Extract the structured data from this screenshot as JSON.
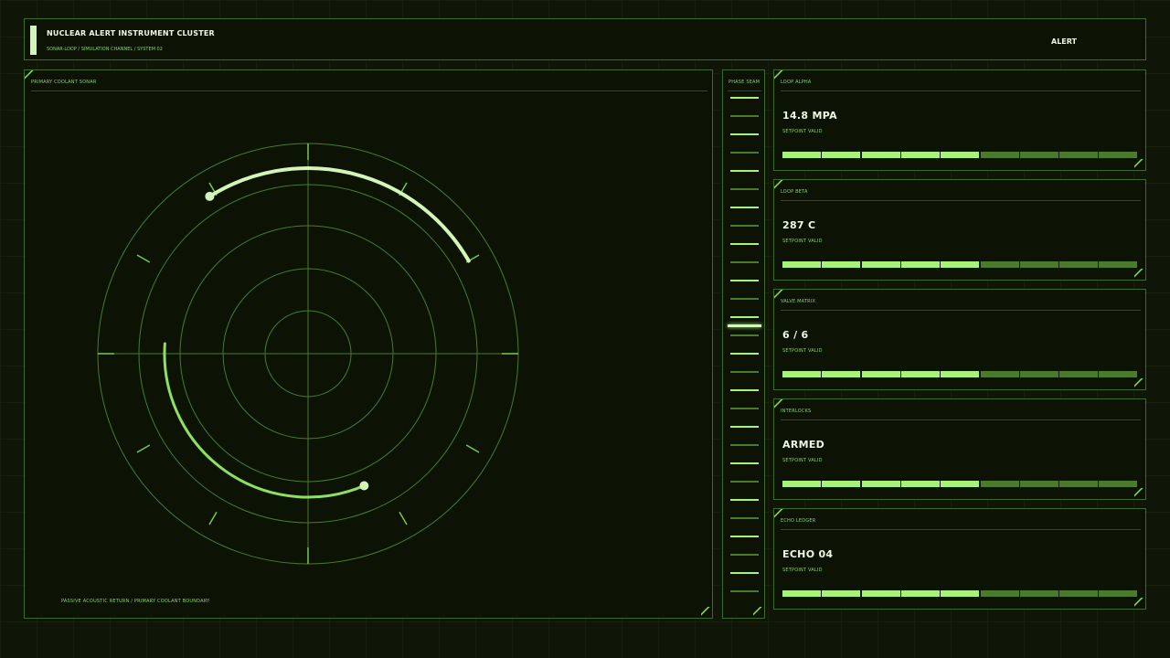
{
  "header": {
    "title": "NUCLEAR ALERT INSTRUMENT CLUSTER",
    "subtitle": "SONAR-LOOP / SIMULATION CHANNEL / SYSTEM 02",
    "status": "ALERT"
  },
  "sonar": {
    "label": "PRIMARY COOLANT SONAR",
    "footer": "PASSIVE ACOUSTIC RETURN / PRIMARY COOLANT BOUNDARY"
  },
  "seam": {
    "label": "PHASE SEAM",
    "tick_count": 28,
    "active_index": 12
  },
  "colors": {
    "accent": "#7ac94a",
    "bright": "#a8f27a",
    "dim": "#4a7a2a",
    "arc_light": "#d4f5b8",
    "text": "#eef8e2"
  },
  "cards": [
    {
      "label": "LOOP ALPHA",
      "value": "14.8 MPA",
      "sub": "SETPOINT  VALID",
      "level": 5,
      "segments": 9
    },
    {
      "label": "LOOP BETA",
      "value": "287 C",
      "sub": "SETPOINT  VALID",
      "level": 5,
      "segments": 9
    },
    {
      "label": "VALVE MATRIX",
      "value": "6 / 6",
      "sub": "SETPOINT  VALID",
      "level": 5,
      "segments": 9
    },
    {
      "label": "INTERLOCKS",
      "value": "ARMED",
      "sub": "SETPOINT  VALID",
      "level": 5,
      "segments": 9
    },
    {
      "label": "ECHO LEDGER",
      "value": "ECHO 04",
      "sub": "SETPOINT  VALID",
      "level": 5,
      "segments": 9
    }
  ]
}
